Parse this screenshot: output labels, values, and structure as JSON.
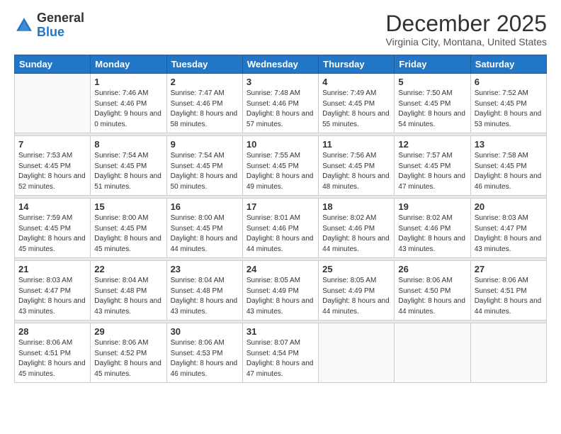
{
  "logo": {
    "general": "General",
    "blue": "Blue"
  },
  "header": {
    "title": "December 2025",
    "subtitle": "Virginia City, Montana, United States"
  },
  "weekdays": [
    "Sunday",
    "Monday",
    "Tuesday",
    "Wednesday",
    "Thursday",
    "Friday",
    "Saturday"
  ],
  "weeks": [
    [
      {
        "day": "",
        "sunrise": "",
        "sunset": "",
        "daylight": ""
      },
      {
        "day": "1",
        "sunrise": "Sunrise: 7:46 AM",
        "sunset": "Sunset: 4:46 PM",
        "daylight": "Daylight: 9 hours and 0 minutes."
      },
      {
        "day": "2",
        "sunrise": "Sunrise: 7:47 AM",
        "sunset": "Sunset: 4:46 PM",
        "daylight": "Daylight: 8 hours and 58 minutes."
      },
      {
        "day": "3",
        "sunrise": "Sunrise: 7:48 AM",
        "sunset": "Sunset: 4:46 PM",
        "daylight": "Daylight: 8 hours and 57 minutes."
      },
      {
        "day": "4",
        "sunrise": "Sunrise: 7:49 AM",
        "sunset": "Sunset: 4:45 PM",
        "daylight": "Daylight: 8 hours and 55 minutes."
      },
      {
        "day": "5",
        "sunrise": "Sunrise: 7:50 AM",
        "sunset": "Sunset: 4:45 PM",
        "daylight": "Daylight: 8 hours and 54 minutes."
      },
      {
        "day": "6",
        "sunrise": "Sunrise: 7:52 AM",
        "sunset": "Sunset: 4:45 PM",
        "daylight": "Daylight: 8 hours and 53 minutes."
      }
    ],
    [
      {
        "day": "7",
        "sunrise": "Sunrise: 7:53 AM",
        "sunset": "Sunset: 4:45 PM",
        "daylight": "Daylight: 8 hours and 52 minutes."
      },
      {
        "day": "8",
        "sunrise": "Sunrise: 7:54 AM",
        "sunset": "Sunset: 4:45 PM",
        "daylight": "Daylight: 8 hours and 51 minutes."
      },
      {
        "day": "9",
        "sunrise": "Sunrise: 7:54 AM",
        "sunset": "Sunset: 4:45 PM",
        "daylight": "Daylight: 8 hours and 50 minutes."
      },
      {
        "day": "10",
        "sunrise": "Sunrise: 7:55 AM",
        "sunset": "Sunset: 4:45 PM",
        "daylight": "Daylight: 8 hours and 49 minutes."
      },
      {
        "day": "11",
        "sunrise": "Sunrise: 7:56 AM",
        "sunset": "Sunset: 4:45 PM",
        "daylight": "Daylight: 8 hours and 48 minutes."
      },
      {
        "day": "12",
        "sunrise": "Sunrise: 7:57 AM",
        "sunset": "Sunset: 4:45 PM",
        "daylight": "Daylight: 8 hours and 47 minutes."
      },
      {
        "day": "13",
        "sunrise": "Sunrise: 7:58 AM",
        "sunset": "Sunset: 4:45 PM",
        "daylight": "Daylight: 8 hours and 46 minutes."
      }
    ],
    [
      {
        "day": "14",
        "sunrise": "Sunrise: 7:59 AM",
        "sunset": "Sunset: 4:45 PM",
        "daylight": "Daylight: 8 hours and 45 minutes."
      },
      {
        "day": "15",
        "sunrise": "Sunrise: 8:00 AM",
        "sunset": "Sunset: 4:45 PM",
        "daylight": "Daylight: 8 hours and 45 minutes."
      },
      {
        "day": "16",
        "sunrise": "Sunrise: 8:00 AM",
        "sunset": "Sunset: 4:45 PM",
        "daylight": "Daylight: 8 hours and 44 minutes."
      },
      {
        "day": "17",
        "sunrise": "Sunrise: 8:01 AM",
        "sunset": "Sunset: 4:46 PM",
        "daylight": "Daylight: 8 hours and 44 minutes."
      },
      {
        "day": "18",
        "sunrise": "Sunrise: 8:02 AM",
        "sunset": "Sunset: 4:46 PM",
        "daylight": "Daylight: 8 hours and 44 minutes."
      },
      {
        "day": "19",
        "sunrise": "Sunrise: 8:02 AM",
        "sunset": "Sunset: 4:46 PM",
        "daylight": "Daylight: 8 hours and 43 minutes."
      },
      {
        "day": "20",
        "sunrise": "Sunrise: 8:03 AM",
        "sunset": "Sunset: 4:47 PM",
        "daylight": "Daylight: 8 hours and 43 minutes."
      }
    ],
    [
      {
        "day": "21",
        "sunrise": "Sunrise: 8:03 AM",
        "sunset": "Sunset: 4:47 PM",
        "daylight": "Daylight: 8 hours and 43 minutes."
      },
      {
        "day": "22",
        "sunrise": "Sunrise: 8:04 AM",
        "sunset": "Sunset: 4:48 PM",
        "daylight": "Daylight: 8 hours and 43 minutes."
      },
      {
        "day": "23",
        "sunrise": "Sunrise: 8:04 AM",
        "sunset": "Sunset: 4:48 PM",
        "daylight": "Daylight: 8 hours and 43 minutes."
      },
      {
        "day": "24",
        "sunrise": "Sunrise: 8:05 AM",
        "sunset": "Sunset: 4:49 PM",
        "daylight": "Daylight: 8 hours and 43 minutes."
      },
      {
        "day": "25",
        "sunrise": "Sunrise: 8:05 AM",
        "sunset": "Sunset: 4:49 PM",
        "daylight": "Daylight: 8 hours and 44 minutes."
      },
      {
        "day": "26",
        "sunrise": "Sunrise: 8:06 AM",
        "sunset": "Sunset: 4:50 PM",
        "daylight": "Daylight: 8 hours and 44 minutes."
      },
      {
        "day": "27",
        "sunrise": "Sunrise: 8:06 AM",
        "sunset": "Sunset: 4:51 PM",
        "daylight": "Daylight: 8 hours and 44 minutes."
      }
    ],
    [
      {
        "day": "28",
        "sunrise": "Sunrise: 8:06 AM",
        "sunset": "Sunset: 4:51 PM",
        "daylight": "Daylight: 8 hours and 45 minutes."
      },
      {
        "day": "29",
        "sunrise": "Sunrise: 8:06 AM",
        "sunset": "Sunset: 4:52 PM",
        "daylight": "Daylight: 8 hours and 45 minutes."
      },
      {
        "day": "30",
        "sunrise": "Sunrise: 8:06 AM",
        "sunset": "Sunset: 4:53 PM",
        "daylight": "Daylight: 8 hours and 46 minutes."
      },
      {
        "day": "31",
        "sunrise": "Sunrise: 8:07 AM",
        "sunset": "Sunset: 4:54 PM",
        "daylight": "Daylight: 8 hours and 47 minutes."
      },
      {
        "day": "",
        "sunrise": "",
        "sunset": "",
        "daylight": ""
      },
      {
        "day": "",
        "sunrise": "",
        "sunset": "",
        "daylight": ""
      },
      {
        "day": "",
        "sunrise": "",
        "sunset": "",
        "daylight": ""
      }
    ]
  ]
}
